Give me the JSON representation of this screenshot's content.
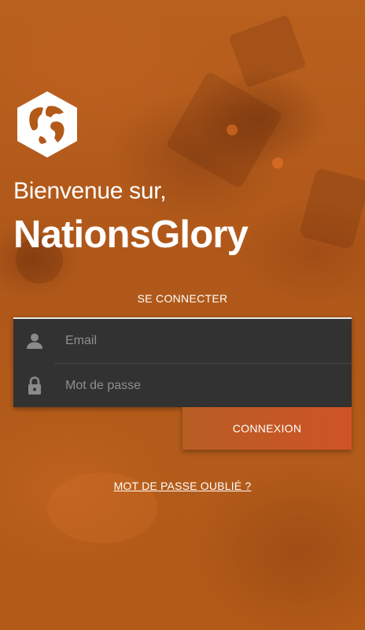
{
  "header": {
    "welcome_text": "Bienvenue sur,",
    "brand_name": "NationsGlory"
  },
  "login": {
    "section_title": "SE CONNECTER",
    "email_placeholder": "Email",
    "password_placeholder": "Mot de passe",
    "submit_label": "CONNEXION",
    "forgot_label": "MOT DE PASSE OUBLIÉ ?"
  },
  "icons": {
    "logo": "globe-hexagon-logo",
    "email": "person-icon",
    "password": "lock-icon"
  },
  "colors": {
    "background": "#b45a19",
    "card": "#323232",
    "button_start": "#b75e24",
    "button_end": "#cf5325",
    "text": "#ffffff"
  }
}
